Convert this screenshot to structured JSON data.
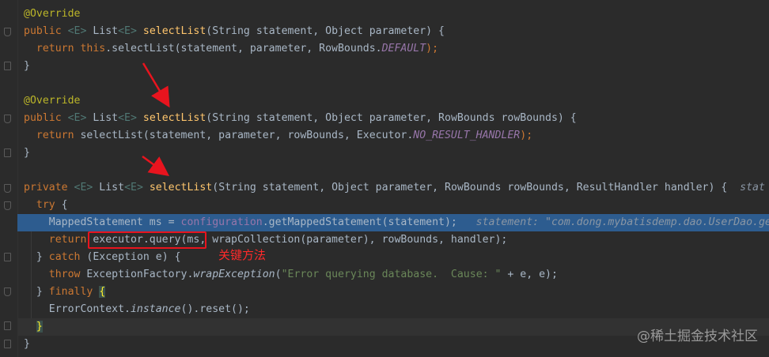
{
  "code": {
    "l1": "@Override",
    "l2": {
      "kw": "public ",
      "g1": "<E>",
      "t1": " List",
      "g2": "<E>",
      "sp": " ",
      "fn": "selectList",
      "rest": "(String statement, Object parameter) {"
    },
    "l3": {
      "kw": "return ",
      "kw2": "this",
      "mid": ".selectList(statement, parameter, RowBounds.",
      "fld": "DEFAULT",
      "end": ");"
    },
    "l4": "}",
    "l6": "@Override",
    "l7": {
      "kw": "public ",
      "g1": "<E>",
      "t1": " List",
      "g2": "<E>",
      "sp": " ",
      "fn": "selectList",
      "rest": "(String statement, Object parameter, RowBounds rowBounds) {"
    },
    "l8": {
      "kw": "return ",
      "mid": "selectList(statement, parameter, rowBounds, Executor.",
      "fld": "NO_RESULT_HANDLER",
      "end": ");"
    },
    "l9": "}",
    "l11": {
      "kw": "private ",
      "g1": "<E>",
      "t1": " List",
      "g2": "<E>",
      "sp": " ",
      "fn": "selectList",
      "rest": "(String statement, Object parameter, RowBounds rowBounds, ResultHandler handler) {",
      "hint": "  stat"
    },
    "l12": {
      "kw": "try",
      "rest": " {"
    },
    "l13": {
      "a": "MappedStatement ms = ",
      "cfg": "configuration",
      "b": ".getMappedStatement(statement);",
      "hint": "   statement: \"com.dong.mybatisdemp.dao.UserDao.ge"
    },
    "l14": {
      "kw": "return ",
      "a": "executor.query(ms, wrapCollection(parameter), rowBounds, handler);"
    },
    "l15": {
      "a": "} ",
      "kw": "catch",
      "b": " (Exception e) {"
    },
    "l16": {
      "kw": "throw ",
      "a": "ExceptionFactory.",
      "it": "wrapException",
      "b": "(",
      "str": "\"Error querying database.  Cause: \"",
      "c": " + e, e);"
    },
    "l17": {
      "a": "} ",
      "kw": "finally",
      "b": " ",
      "brace": "{"
    },
    "l18": {
      "a": "ErrorContext.",
      "it": "instance",
      "b": "().reset();"
    },
    "l19": {
      "brace": "}"
    },
    "l20": "}"
  },
  "annotation": {
    "note": "关键方法"
  },
  "watermark": "@稀土掘金技术社区",
  "colors": {
    "accent_red": "#e8141e",
    "selection": "#2d5c8f",
    "background": "#2b2b2b"
  }
}
